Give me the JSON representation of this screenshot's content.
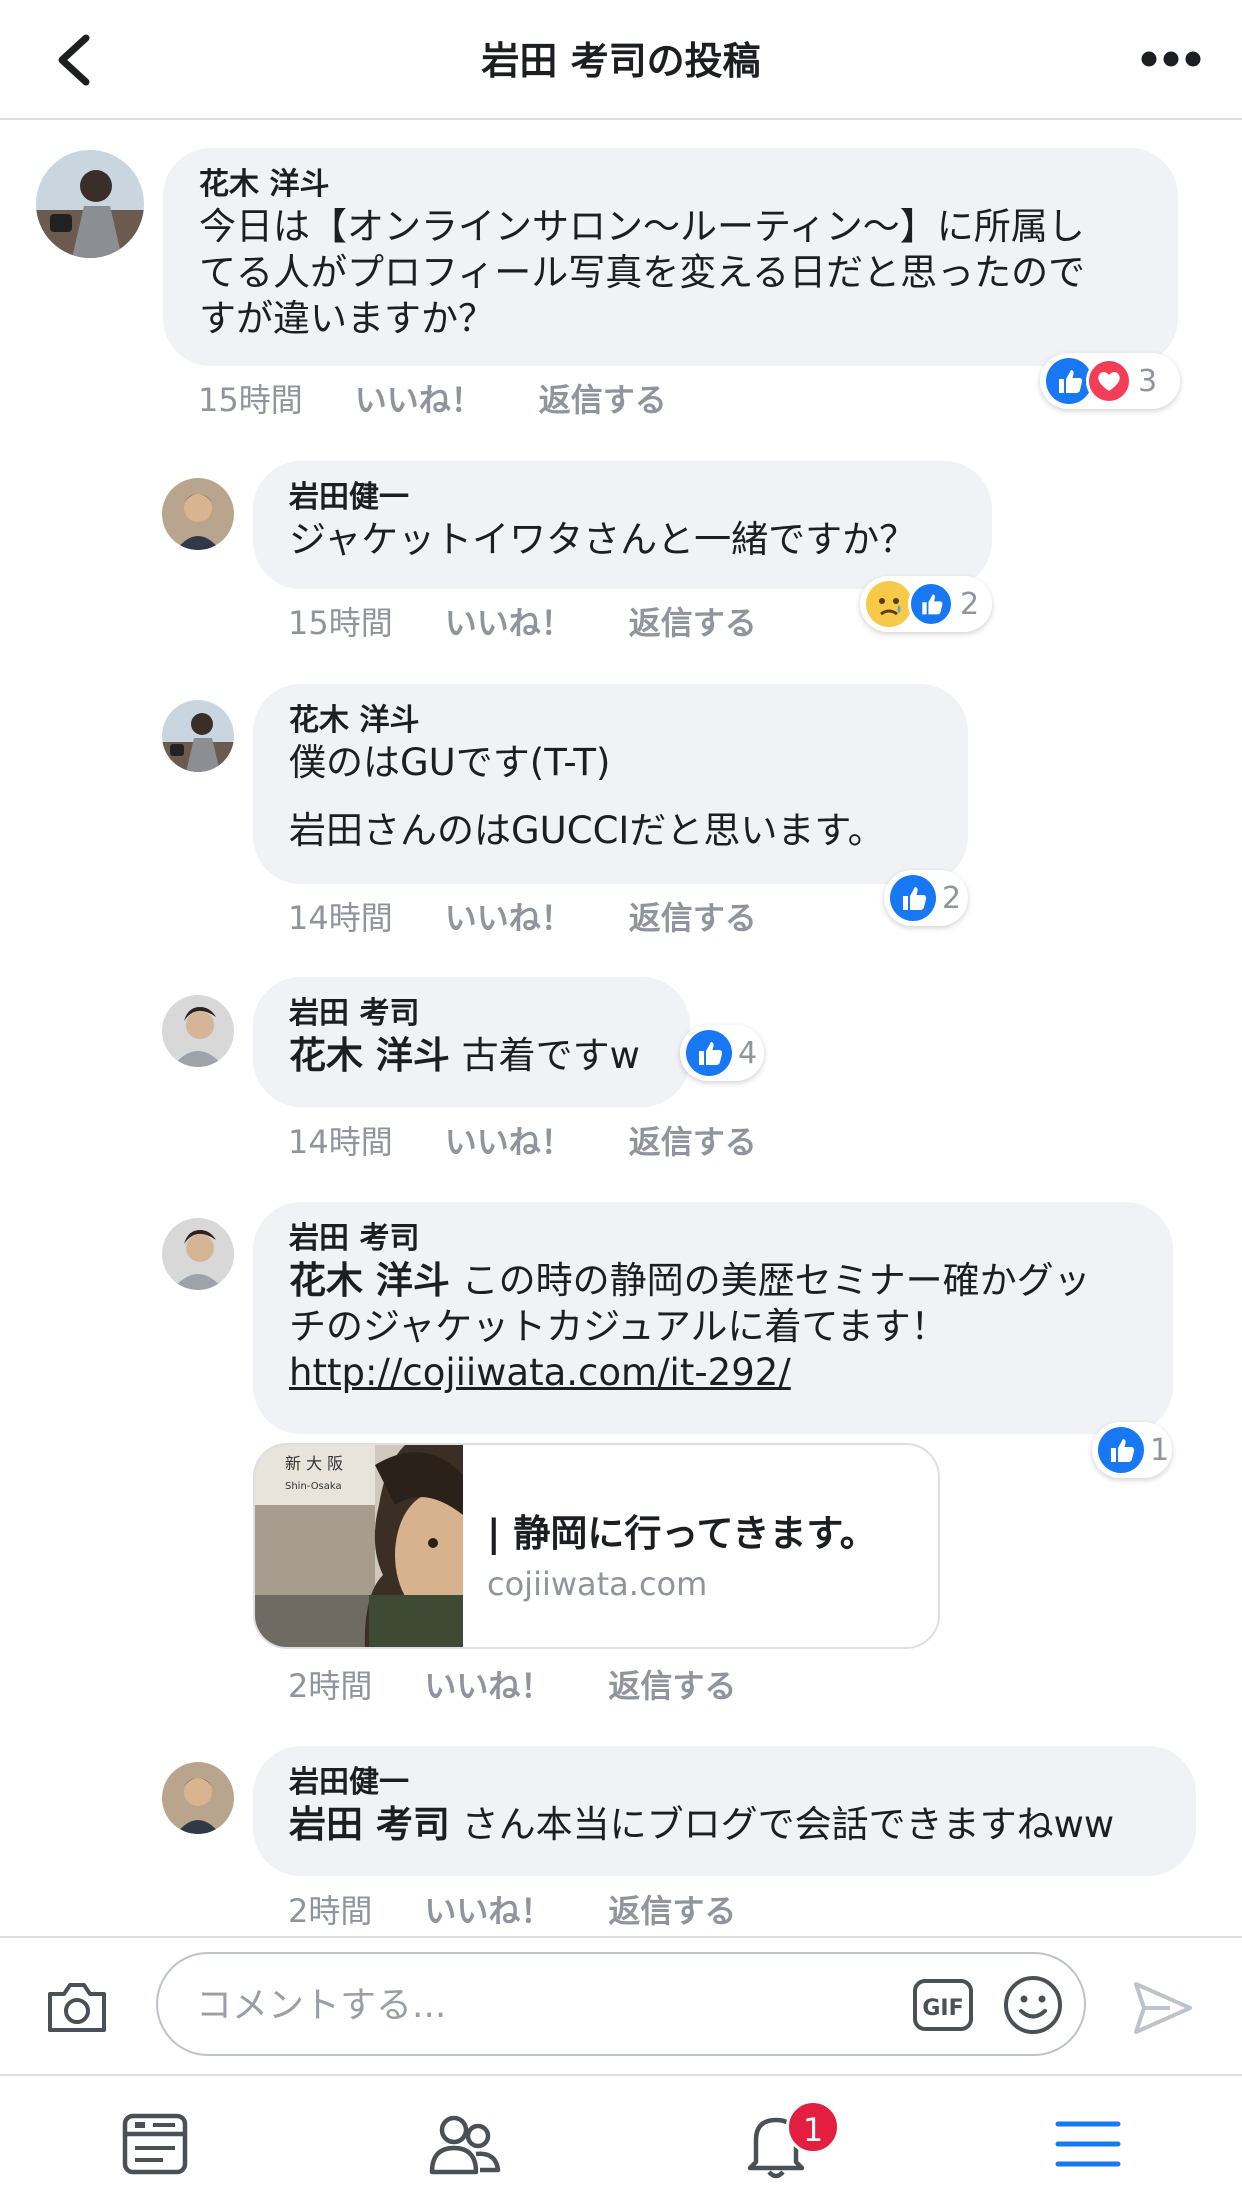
{
  "header": {
    "title": "岩田 考司の投稿"
  },
  "comments": [
    {
      "author": "花木 洋斗",
      "lines": [
        "今日は【オンラインサロン〜ルーティン〜】に所属し",
        "てる人がプロフィール写真を変える日だと思ったので",
        "すが違いますか？"
      ],
      "time": "15時間",
      "like": "いいね！",
      "reply": "返信する",
      "reaction_count": "3",
      "reactions": [
        "like",
        "love"
      ]
    },
    {
      "author": "岩田健一",
      "lines": [
        "ジャケットイワタさんと一緒ですか？"
      ],
      "time": "15時間",
      "like": "いいね！",
      "reply": "返信する",
      "reaction_count": "2",
      "reactions": [
        "sad",
        "like"
      ]
    },
    {
      "author": "花木 洋斗",
      "lines": [
        "僕のはGUです(T-T)",
        "岩田さんのはGUCCIだと思います。"
      ],
      "time": "14時間",
      "like": "いいね！",
      "reply": "返信する",
      "reaction_count": "2",
      "reactions": [
        "like"
      ]
    },
    {
      "author": "岩田 考司",
      "mention": "花木 洋斗",
      "lines": [
        " 古着ですw"
      ],
      "time": "14時間",
      "like": "いいね！",
      "reply": "返信する",
      "reaction_count": "4",
      "reactions": [
        "like"
      ]
    },
    {
      "author": "岩田 考司",
      "mention": "花木 洋斗",
      "lines": [
        " この時の静岡の美歴セミナー確かグッ",
        "チのジャケットカジュアルに着てます！"
      ],
      "link": "http://cojiiwata.com/it-292/",
      "time": "2時間",
      "like": "いいね！",
      "reply": "返信する",
      "reaction_count": "1",
      "reactions": [
        "like"
      ],
      "preview": {
        "title": "| 静岡に行ってきます。",
        "domain": "cojiiwata.com",
        "sign_text": "新 大 阪",
        "sign_sub": "Shin-Osaka"
      }
    },
    {
      "author": "岩田健一",
      "mention": "岩田 考司",
      "lines": [
        " さん本当にブログで会話できますねww"
      ],
      "time": "2時間",
      "like": "いいね！",
      "reply": "返信する"
    }
  ],
  "composer": {
    "placeholder": "コメントする..."
  },
  "tabbar": {
    "notification_badge": "1"
  },
  "colors": {
    "like_blue": "#1877f2",
    "love_red": "#f33e58",
    "badge_red": "#e41e3f",
    "menu_blue": "#1877f2",
    "bubble_gray": "#f0f2f5"
  }
}
